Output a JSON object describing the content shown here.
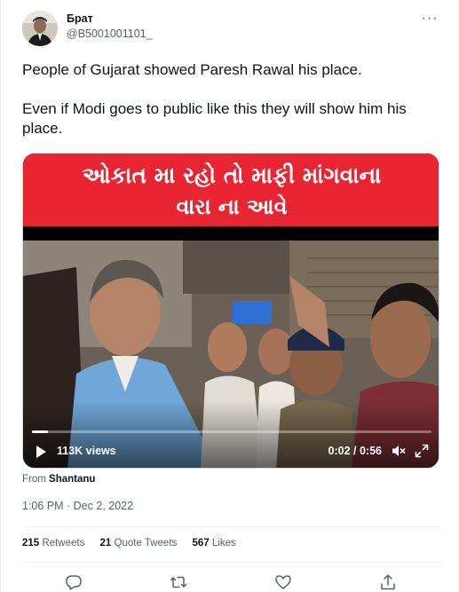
{
  "author": {
    "display_name": "Брат",
    "handle": "@B5001001101_",
    "avatar_icon": "user-avatar"
  },
  "tweet": {
    "paragraphs": [
      "People of Gujarat showed Paresh Rawal his place.",
      "Even if Modi goes to public like this they will show him his place."
    ]
  },
  "media": {
    "banner_line_1": "ઓકાત મા રહો તો માફી માંગવાના",
    "banner_line_2": "વારા ના આવે",
    "banner_color": "#ea2533",
    "views": "113K views",
    "time": "0:02 / 0:56",
    "progress_fraction": 0.04,
    "play_icon": "play-icon",
    "mute_icon": "mute-icon",
    "expand_icon": "expand-icon"
  },
  "source": {
    "prefix": "From",
    "name": "Shantanu"
  },
  "timestamp": "1:06 PM · Dec 2, 2022",
  "stats": {
    "retweets_count": "215",
    "retweets_label": "Retweets",
    "quotes_count": "21",
    "quotes_label": "Quote Tweets",
    "likes_count": "567",
    "likes_label": "Likes"
  },
  "actions": [
    "reply-icon",
    "retweet-icon",
    "like-icon",
    "share-icon"
  ],
  "colors": {
    "text_primary": "#0f1419",
    "text_secondary": "#536471",
    "divider": "#eff3f4"
  }
}
